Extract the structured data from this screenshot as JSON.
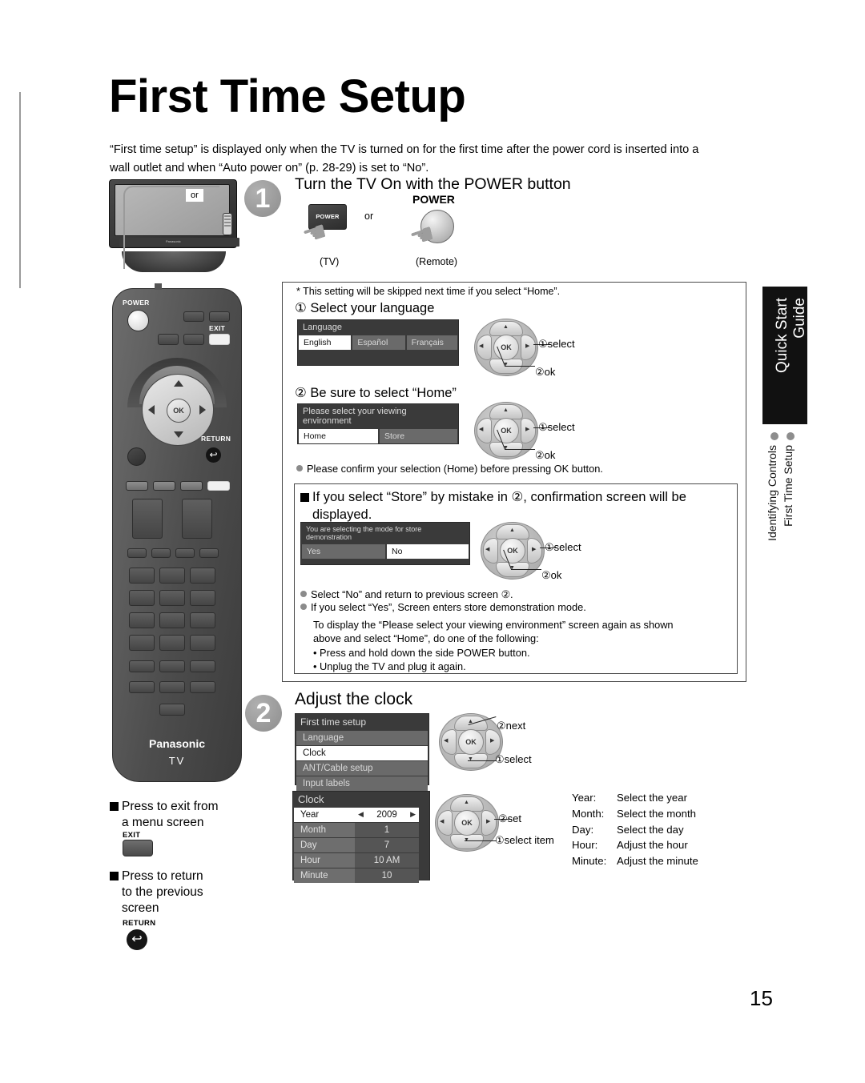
{
  "page": {
    "title": "First Time Setup",
    "intro": "“First time setup” is displayed only when the TV is turned on for the first time after the power cord is inserted into a wall outlet and when “Auto power on” (p. 28-29) is set to “No”.",
    "number": "15"
  },
  "tv_illustration": {
    "or_label": "or",
    "brand": "Panasonic"
  },
  "remote": {
    "power_label": "POWER",
    "exit_label": "EXIT",
    "return_label": "RETURN",
    "ok_label": "OK",
    "return_glyph": "↩",
    "brand": "Panasonic",
    "device": "TV"
  },
  "step1": {
    "number": "1",
    "title": "Turn the TV On with the POWER button",
    "tv_button_label": "POWER",
    "or_label": "or",
    "remote_power_label": "POWER",
    "tv_caption": "(TV)",
    "remote_caption": "(Remote)"
  },
  "box": {
    "note_star": "*  This setting will be skipped next time if you select “Home”.",
    "sub1": "① Select your language",
    "language_panel": {
      "title": "Language",
      "options": [
        "English",
        "Español",
        "Français"
      ],
      "selected": "English"
    },
    "dpad1": {
      "callout1": "①select",
      "callout2": "②ok",
      "ok": "OK"
    },
    "sub2": "② Be sure to select “Home”",
    "viewing_panel": {
      "title": "Please select your viewing environment",
      "options": [
        "Home",
        "Store"
      ],
      "selected": "Home"
    },
    "dpad2": {
      "callout1": "①select",
      "callout2": "②ok",
      "ok": "OK"
    },
    "confirm_bullet": "Please confirm your selection (Home) before pressing OK button.",
    "store_heading_line1": "If you select “Store” by mistake in ②, confirmation screen will be",
    "store_heading_line2": "displayed.",
    "store_panel": {
      "title": "You are selecting the mode for store demonstration",
      "options": [
        "Yes",
        "No"
      ],
      "selected": "No"
    },
    "dpad3": {
      "callout1": "①select",
      "callout2": "②ok",
      "ok": "OK"
    },
    "bullets": [
      "Select “No” and return to previous screen ②.",
      "If you select “Yes”, Screen enters store demonstration mode."
    ],
    "paragraph": [
      "To display the “Please select your viewing environment” screen again as shown",
      "above and select “Home”, do one of the following:",
      "• Press and hold down the side POWER button.",
      "• Unplug the TV and plug it again."
    ]
  },
  "step2": {
    "number": "2",
    "title": "Adjust the clock",
    "menu_panel": {
      "title": "First time setup",
      "items": [
        "Language",
        "Clock",
        "ANT/Cable setup",
        "Input labels"
      ],
      "selected": "Clock"
    },
    "dpad_menu": {
      "callout1": "②next",
      "callout2": "①select",
      "ok": "OK"
    },
    "clock_panel": {
      "title": "Clock",
      "rows": [
        {
          "key": "Year",
          "value": "2009",
          "selected": true
        },
        {
          "key": "Month",
          "value": "1",
          "selected": false
        },
        {
          "key": "Day",
          "value": "7",
          "selected": false
        },
        {
          "key": "Hour",
          "value": "10 AM",
          "selected": false
        },
        {
          "key": "Minute",
          "value": "10",
          "selected": false
        }
      ],
      "left_arrow": "◀",
      "right_arrow": "▶"
    },
    "dpad_clock": {
      "callout1": "②set",
      "callout2": "①select item",
      "ok": "OK"
    },
    "legend": [
      {
        "key": "Year:",
        "desc": "Select the year"
      },
      {
        "key": "Month:",
        "desc": "Select the month"
      },
      {
        "key": "Day:",
        "desc": "Select the day"
      },
      {
        "key": "Hour:",
        "desc": "Adjust the hour"
      },
      {
        "key": "Minute:",
        "desc": "Adjust the minute"
      }
    ]
  },
  "bottom_notes": {
    "exit_note_line1": "Press to exit from",
    "exit_note_line2": "a menu screen",
    "exit_key": "EXIT",
    "return_note_line1": "Press to return",
    "return_note_line2": "to the previous",
    "return_note_line3": "screen",
    "return_key": "RETURN",
    "return_glyph": "↩"
  },
  "side_tab": {
    "heading_line1": "Quick Start",
    "heading_line2": "Guide",
    "items": [
      "First Time Setup",
      "Identifying Controls"
    ]
  },
  "colors": {
    "tab_bg": "#111111",
    "osd_bg": "#3a3a3a",
    "osd_row": "#6a6a6a",
    "selected": "#ffffff"
  }
}
